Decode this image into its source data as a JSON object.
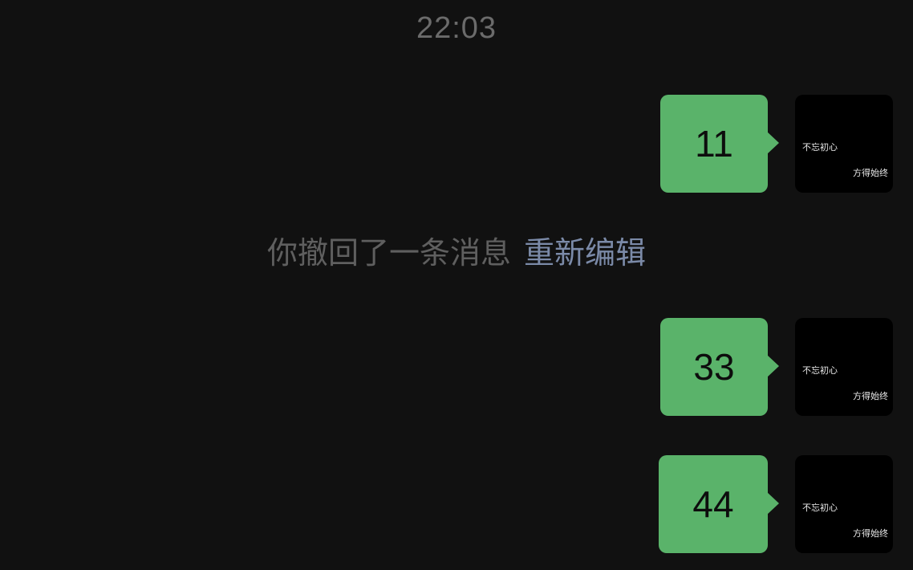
{
  "timestamp": "22:03",
  "avatar": {
    "line1": "不忘初心",
    "line2": "方得始终"
  },
  "messages": [
    {
      "text": "11"
    },
    {
      "text": "33"
    },
    {
      "text": "44"
    }
  ],
  "recall_notice": {
    "text": "你撤回了一条消息",
    "action": "重新编辑"
  },
  "colors": {
    "background": "#111111",
    "bubble": "#5ab36a",
    "link": "#7b8aa8"
  }
}
